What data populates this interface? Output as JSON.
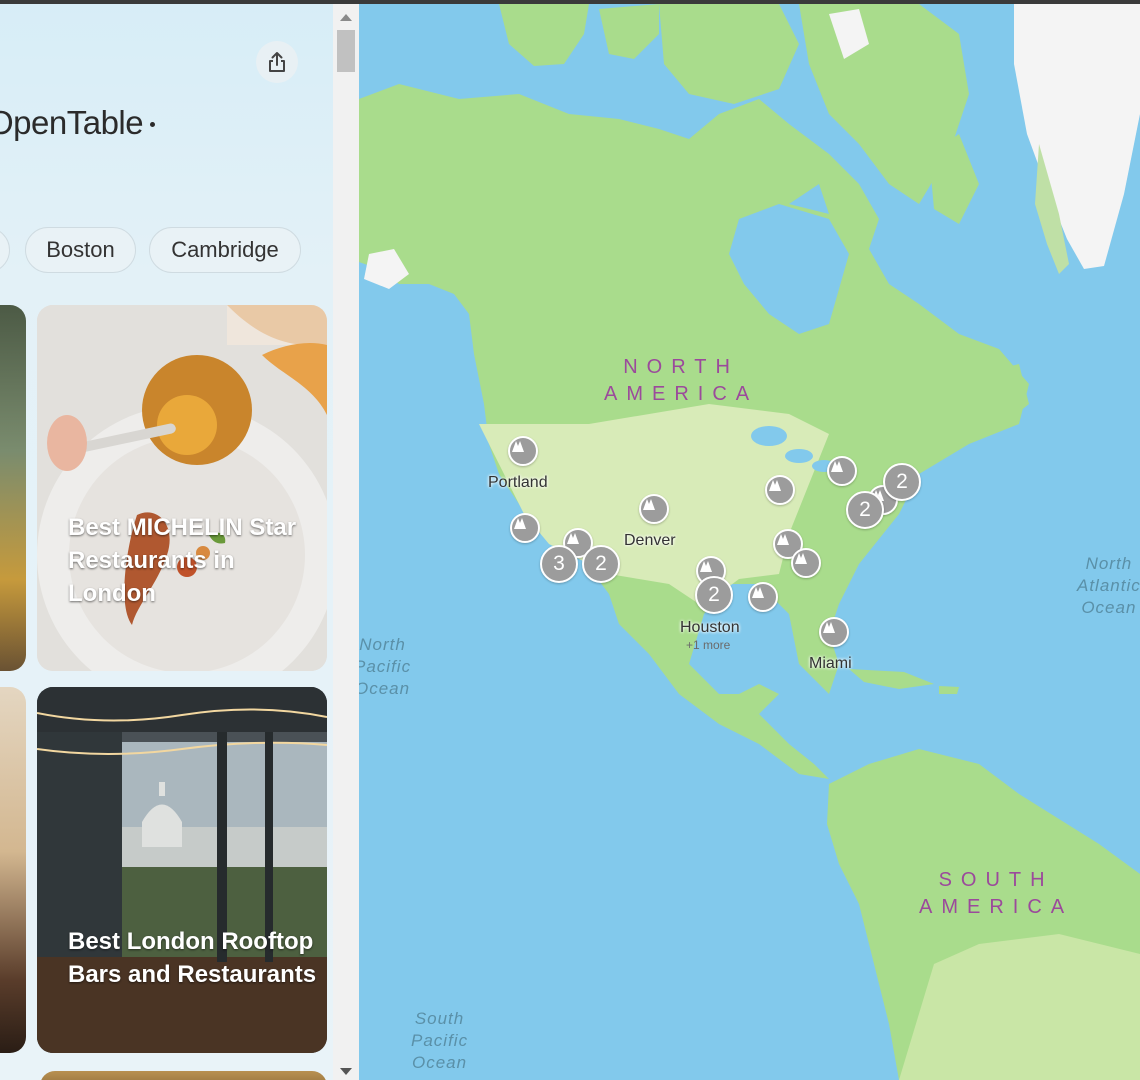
{
  "sidebar": {
    "brand": "OpenTable",
    "share_icon": "share-icon",
    "chips": [
      {
        "label": ""
      },
      {
        "label": "Boston"
      },
      {
        "label": "Cambridge"
      }
    ],
    "cards": [
      {
        "title": "Best MICHELIN Star Restaurants in London"
      },
      {
        "title": "Best London Rooftop Bars and Restaurants"
      }
    ]
  },
  "map": {
    "continents": [
      {
        "label": "NORTH\nAMERICA"
      },
      {
        "label": "SOUTH\nAMERICA"
      }
    ],
    "oceans": [
      {
        "label": "North\nPacific\nOcean"
      },
      {
        "label": "South\nPacific\nOcean"
      },
      {
        "label": "North\nAtlantic\nOcean"
      }
    ],
    "cities": [
      {
        "name": "Portland"
      },
      {
        "name": "Denver"
      },
      {
        "name": "Houston",
        "extra": "+1 more"
      },
      {
        "name": "Miami"
      }
    ],
    "clusters": [
      {
        "count": "3"
      },
      {
        "count": "2"
      },
      {
        "count": "2"
      },
      {
        "count": "2"
      },
      {
        "count": "2"
      }
    ],
    "pin_icon": "restaurant-pin-icon",
    "colors": {
      "water": "#82c9ec",
      "land": "#a9dc8c",
      "ice": "#f4f4f4",
      "pin": "#9c9c9c",
      "continent_label": "#9b4a9b"
    }
  }
}
